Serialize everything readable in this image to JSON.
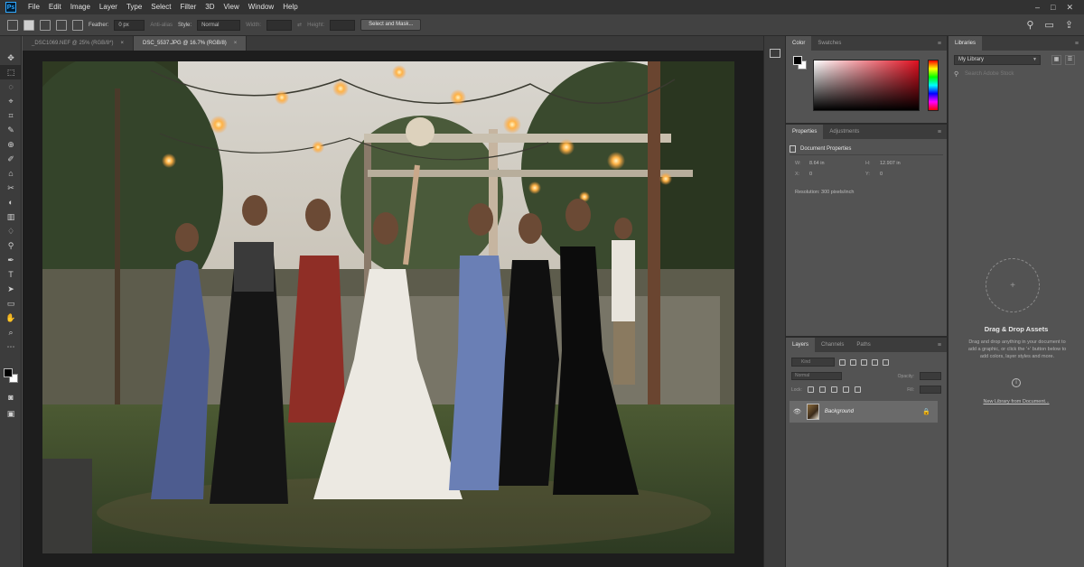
{
  "app": {
    "logo": "Ps",
    "menu": [
      "File",
      "Edit",
      "Image",
      "Layer",
      "Type",
      "Select",
      "Filter",
      "3D",
      "View",
      "Window",
      "Help"
    ]
  },
  "window_controls": [
    "–",
    "□",
    "✕"
  ],
  "options_bar": {
    "feather_label": "Feather:",
    "feather_value": "0 px",
    "anti_alias_label": "Anti-alias",
    "style_label": "Style:",
    "style_value": "Normal",
    "width_label": "Width:",
    "height_label": "Height:",
    "select_mask_button": "Select and Mask..."
  },
  "tools": [
    "✥",
    "⬚",
    "◌",
    "⌖",
    "⌗",
    "✎",
    "⊕",
    "✐",
    "⌂",
    "✂",
    "◐",
    "▥",
    "♢",
    "⚲",
    "✒",
    "T",
    "➤",
    "▭",
    "✋",
    "⌕",
    "⋯"
  ],
  "doc_tabs": [
    {
      "label": "_DSC1069.NEF @ 25% (RGB/8*)",
      "close": "×",
      "active": false
    },
    {
      "label": "DSC_5537.JPG @ 16.7% (RGB/8)",
      "close": "×",
      "active": true
    }
  ],
  "color_panel": {
    "tabs": [
      "Color",
      "Swatches"
    ],
    "menu": "≡"
  },
  "properties_panel": {
    "tabs": [
      "Properties",
      "Adjustments"
    ],
    "title": "Document Properties",
    "w_label": "W:",
    "w_value": "8.64 in",
    "h_label": "H:",
    "h_value": "12.907 in",
    "x_label": "X:",
    "x_value": "0",
    "y_label": "Y:",
    "y_value": "0",
    "resolution": "Resolution: 300 pixels/inch"
  },
  "layers_panel": {
    "tabs": [
      "Layers",
      "Channels",
      "Paths"
    ],
    "kind_placeholder": "Kind",
    "blend_mode": "Normal",
    "opacity_label": "Opacity:",
    "lock_label": "Lock:",
    "fill_label": "Fill:",
    "layer_name": "Background",
    "eye": "👁",
    "lock_icon": "🔒"
  },
  "libraries_panel": {
    "tab": "Libraries",
    "library_name": "My Library",
    "search_placeholder": "Search Adobe Stock",
    "drop_title": "Drag & Drop Assets",
    "drop_text": "Drag and drop anything in your document to add a graphic, or click the '+' button below to add colors, layer styles and more.",
    "info_icon": "i",
    "new_from_doc_link": "New Library from Document..."
  },
  "colors": {
    "accent": "#31a8ff",
    "chrome_dark": "#323232",
    "panel": "#535353"
  }
}
